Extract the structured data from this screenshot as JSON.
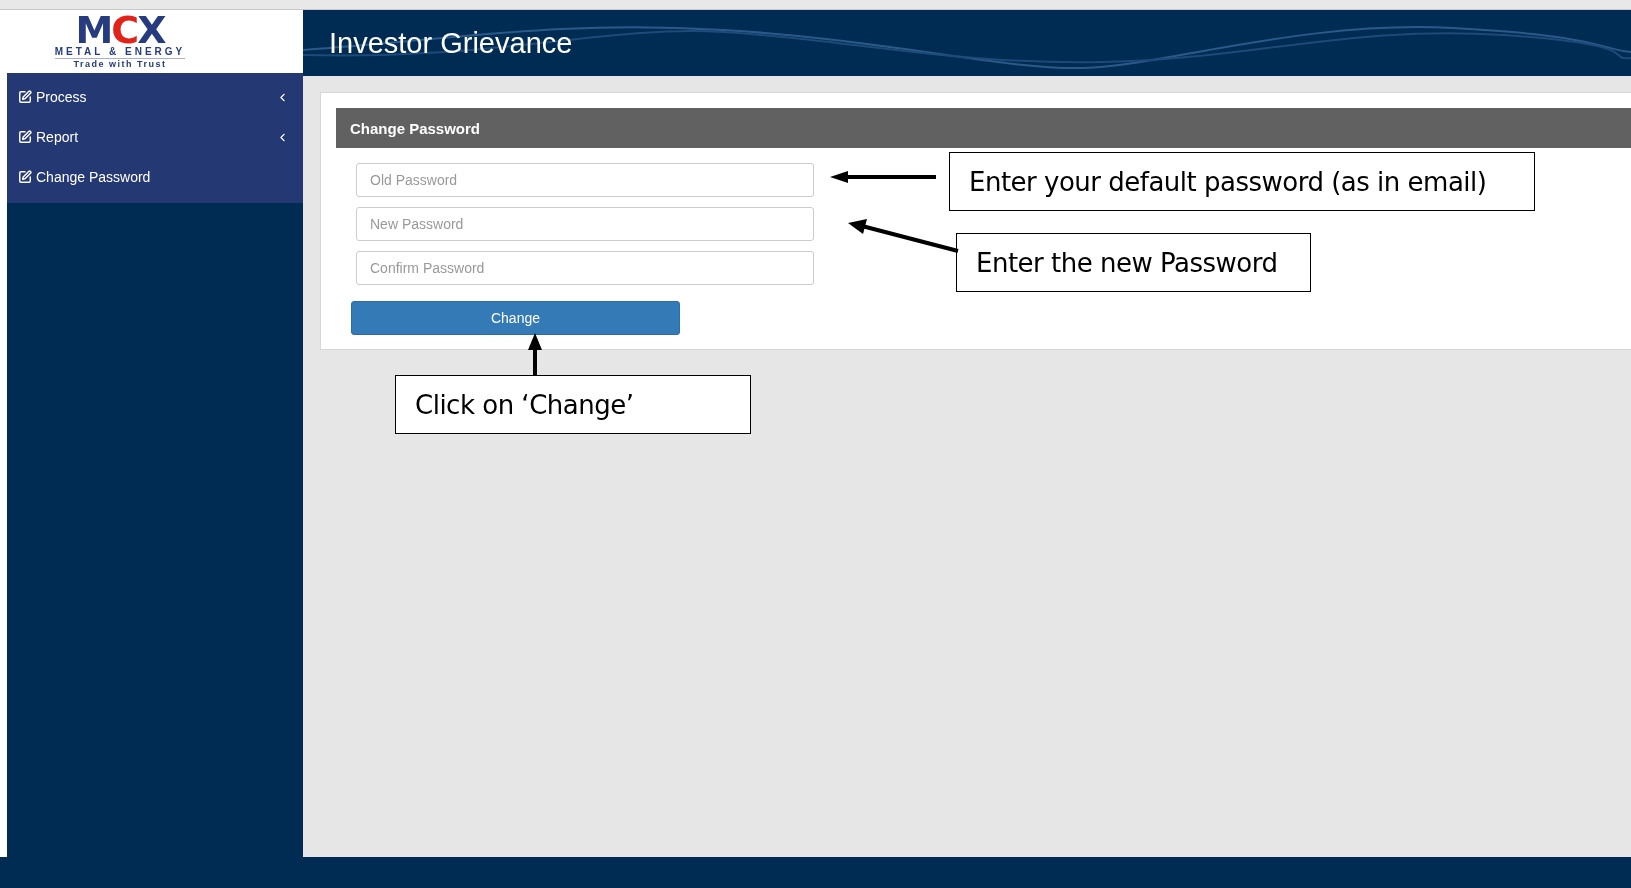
{
  "logo": {
    "letters": [
      {
        "text": "M",
        "color": "#263c7e"
      },
      {
        "text": "C",
        "color": "#e2231a"
      },
      {
        "text": "X",
        "color": "#263c7e"
      }
    ],
    "subtitle": "METAL & ENERGY",
    "tagline": "Trade with Trust"
  },
  "header": {
    "title": "Investor Grievance"
  },
  "sidebar": {
    "items": [
      {
        "label": "Process",
        "has_submenu": true
      },
      {
        "label": "Report",
        "has_submenu": true
      },
      {
        "label": "Change Password",
        "has_submenu": false
      }
    ]
  },
  "panel": {
    "title": "Change Password",
    "fields": [
      {
        "placeholder": "Old Password"
      },
      {
        "placeholder": "New Password"
      },
      {
        "placeholder": "Confirm Password"
      }
    ],
    "button": "Change"
  },
  "annotations": [
    {
      "text": "Enter your default password (as in email)"
    },
    {
      "text": "Enter the new Password"
    },
    {
      "text": "Click on ‘Change’"
    }
  ]
}
